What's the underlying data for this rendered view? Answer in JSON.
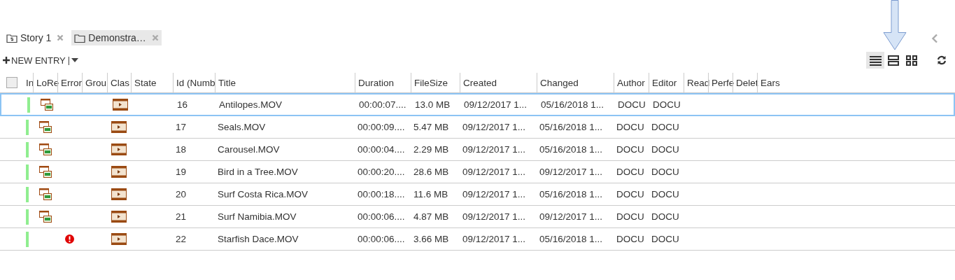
{
  "tabs": [
    {
      "label": "Story 1",
      "kind": "story",
      "selected": false
    },
    {
      "label": "Demonstra…",
      "kind": "folder",
      "selected": true
    }
  ],
  "toolbar": {
    "new_entry": "NEW ENTRY",
    "separator": "|",
    "views": [
      {
        "kind": "list",
        "selected": true
      },
      {
        "kind": "rows",
        "selected": false
      },
      {
        "kind": "grid",
        "selected": false
      }
    ]
  },
  "table": {
    "all_checked": false,
    "columns": [
      "In",
      "LoRe",
      "Error",
      "Grou",
      "Clas",
      "State",
      "Id (Numb",
      "Title",
      "Duration",
      "FileSize",
      "Created",
      "Changed",
      "Author",
      "Editor",
      "Read",
      "Perfe",
      "Delet",
      "Ears"
    ],
    "rows": [
      {
        "selected": true,
        "lores": true,
        "error": false,
        "id": "16",
        "title": "Antilopes.MOV",
        "duration": "00:00:07....",
        "filesize": "13.0 MB",
        "created": "09/12/2017 1...",
        "changed": "05/16/2018 1...",
        "author": "DOCU",
        "editor": "DOCU"
      },
      {
        "selected": false,
        "lores": true,
        "error": false,
        "id": "17",
        "title": "Seals.MOV",
        "duration": "00:00:09....",
        "filesize": "5.47 MB",
        "created": "09/12/2017 1...",
        "changed": "05/16/2018 1...",
        "author": "DOCU",
        "editor": "DOCU"
      },
      {
        "selected": false,
        "lores": true,
        "error": false,
        "id": "18",
        "title": "Carousel.MOV",
        "duration": "00:00:04....",
        "filesize": "2.29 MB",
        "created": "09/12/2017 1...",
        "changed": "05/16/2018 1...",
        "author": "DOCU",
        "editor": "DOCU"
      },
      {
        "selected": false,
        "lores": true,
        "error": false,
        "id": "19",
        "title": "Bird in a Tree.MOV",
        "duration": "00:00:20....",
        "filesize": "28.6 MB",
        "created": "09/12/2017 1...",
        "changed": "09/12/2017 1...",
        "author": "DOCU",
        "editor": "DOCU"
      },
      {
        "selected": false,
        "lores": true,
        "error": false,
        "id": "20",
        "title": "Surf Costa Rica.MOV",
        "duration": "00:00:18....",
        "filesize": "11.6 MB",
        "created": "09/12/2017 1...",
        "changed": "05/16/2018 1...",
        "author": "DOCU",
        "editor": "DOCU"
      },
      {
        "selected": false,
        "lores": true,
        "error": false,
        "id": "21",
        "title": "Surf Namibia.MOV",
        "duration": "00:00:06....",
        "filesize": "4.87 MB",
        "created": "09/12/2017 1...",
        "changed": "09/12/2017 1...",
        "author": "DOCU",
        "editor": "DOCU"
      },
      {
        "selected": false,
        "lores": false,
        "error": true,
        "id": "22",
        "title": "Starfish Dace.MOV",
        "duration": "00:00:06....",
        "filesize": "3.66 MB",
        "created": "09/12/2017 1...",
        "changed": "05/16/2018 1...",
        "author": "DOCU",
        "editor": "DOCU"
      }
    ]
  }
}
